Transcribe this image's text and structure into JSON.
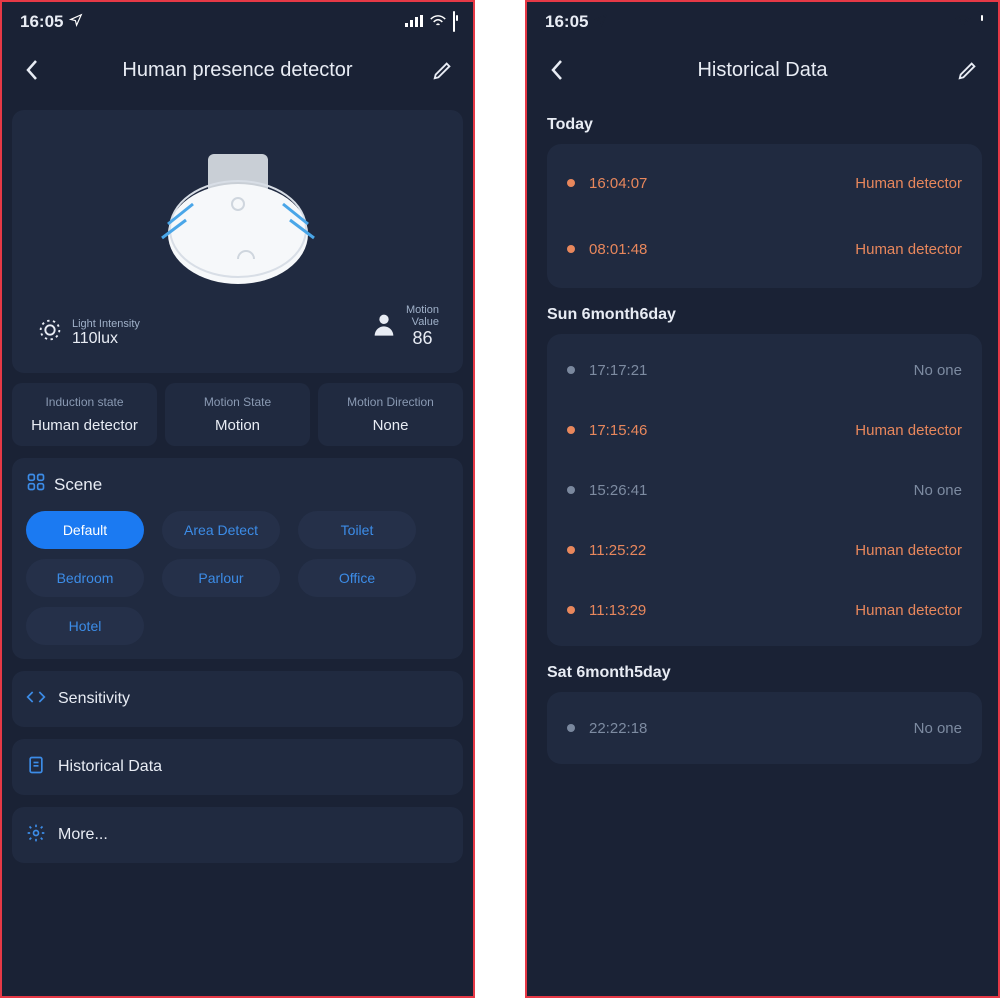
{
  "status": {
    "time": "16:05"
  },
  "left": {
    "title": "Human presence detector",
    "light": {
      "label": "Light Intensity",
      "value": "110lux"
    },
    "motion": {
      "label": "Motion\nValue",
      "value": "86"
    },
    "states": [
      {
        "label": "Induction state",
        "value": "Human detector"
      },
      {
        "label": "Motion State",
        "value": "Motion"
      },
      {
        "label": "Motion Direction",
        "value": "None"
      }
    ],
    "scene": {
      "title": "Scene",
      "options": [
        "Default",
        "Area Detect",
        "Toilet",
        "Bedroom",
        "Parlour",
        "Office",
        "Hotel"
      ],
      "active": 0
    },
    "menu": {
      "sensitivity": "Sensitivity",
      "history": "Historical Data",
      "more": "More..."
    }
  },
  "right": {
    "title": "Historical Data",
    "groups": [
      {
        "heading": "Today",
        "rows": [
          {
            "time": "16:04:07",
            "event": "Human detector",
            "type": "orange"
          },
          {
            "time": "08:01:48",
            "event": "Human detector",
            "type": "orange"
          }
        ]
      },
      {
        "heading": "Sun  6month6day",
        "rows": [
          {
            "time": "17:17:21",
            "event": "No one",
            "type": "grey"
          },
          {
            "time": "17:15:46",
            "event": "Human detector",
            "type": "orange"
          },
          {
            "time": "15:26:41",
            "event": "No one",
            "type": "grey"
          },
          {
            "time": "11:25:22",
            "event": "Human detector",
            "type": "orange"
          },
          {
            "time": "11:13:29",
            "event": "Human detector",
            "type": "orange"
          }
        ]
      },
      {
        "heading": "Sat  6month5day",
        "rows": [
          {
            "time": "22:22:18",
            "event": "No one",
            "type": "grey"
          }
        ]
      }
    ]
  }
}
